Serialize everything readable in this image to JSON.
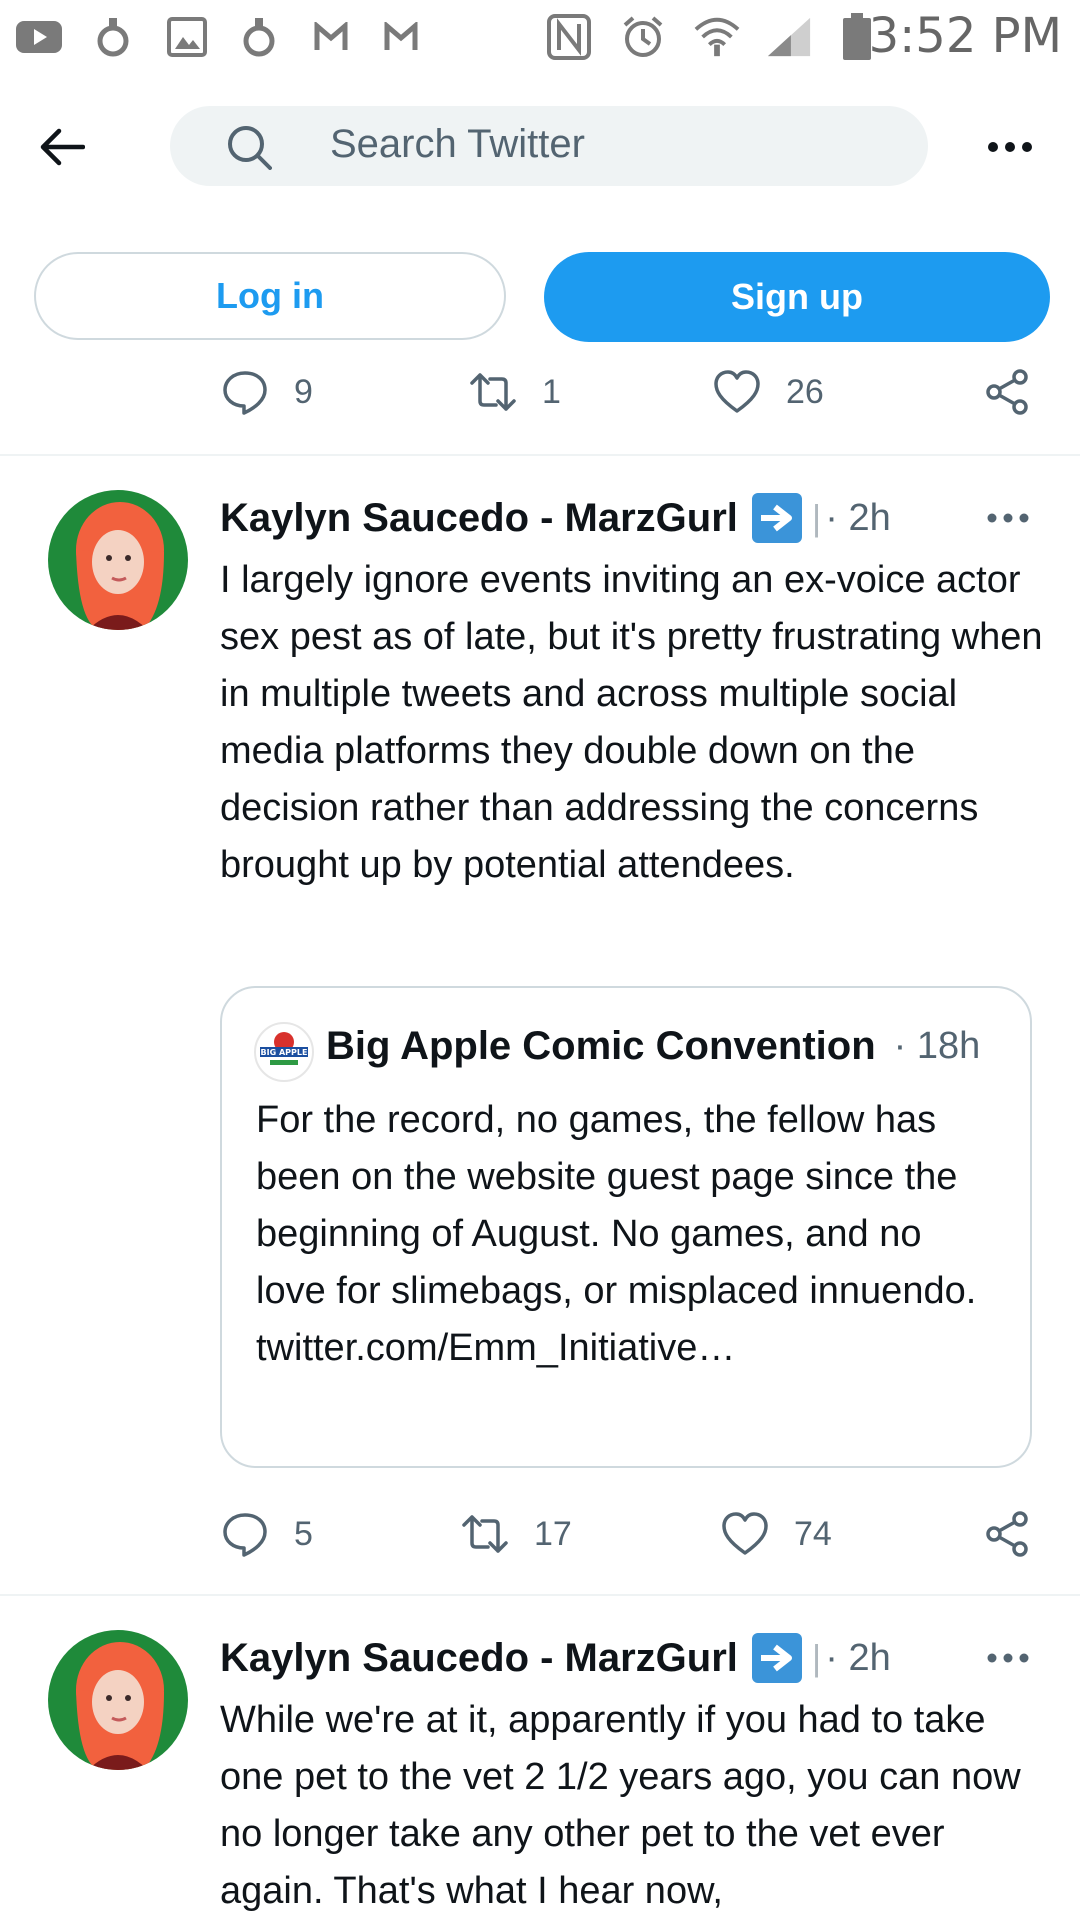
{
  "status_bar": {
    "time": "3:52 PM",
    "icons": [
      "youtube-icon",
      "app-icon",
      "gallery-icon",
      "app-icon",
      "gmail-icon",
      "gmail-icon",
      "nfc-icon",
      "alarm-icon",
      "wifi-icon",
      "signal-icon",
      "battery-icon"
    ]
  },
  "header": {
    "search_placeholder": "Search Twitter"
  },
  "auth": {
    "login_label": "Log in",
    "signup_label": "Sign up"
  },
  "tweet0_actions": {
    "replies": "9",
    "retweets": "1",
    "likes": "26"
  },
  "tweet1": {
    "name": "Kaylyn Saucedo - MarzGurl",
    "separator": "|",
    "time": "· 2h",
    "text": "I largely ignore events inviting an ex-voice actor sex pest as of late, but it's pretty frustrating when in multiple tweets and across multiple social media platforms they double down on the decision rather than addressing the concerns brought up by potential attendees.",
    "quote": {
      "avatar_text": "BIG APPLE",
      "name": "Big Apple Comic Convention",
      "time": "· 18h",
      "text": "For the record, no games, the fellow has been on the website guest page since the beginning of August. No games, and no love for slimebags, or misplaced innuendo.",
      "link": "twitter.com/Emm_Initiative…"
    },
    "actions": {
      "replies": "5",
      "retweets": "17",
      "likes": "74"
    }
  },
  "tweet2": {
    "name": "Kaylyn Saucedo - MarzGurl",
    "separator": "|",
    "time": "· 2h",
    "text": "While we're at it, apparently if you had to take one pet to the vet 2 1/2 years ago, you can now no longer take any other pet to the vet ever again. That's what I hear now,"
  },
  "colors": {
    "accent": "#1d9bf0",
    "secondary_text": "#536471",
    "divider": "#eff3f4",
    "badge": "#3b94d9"
  }
}
